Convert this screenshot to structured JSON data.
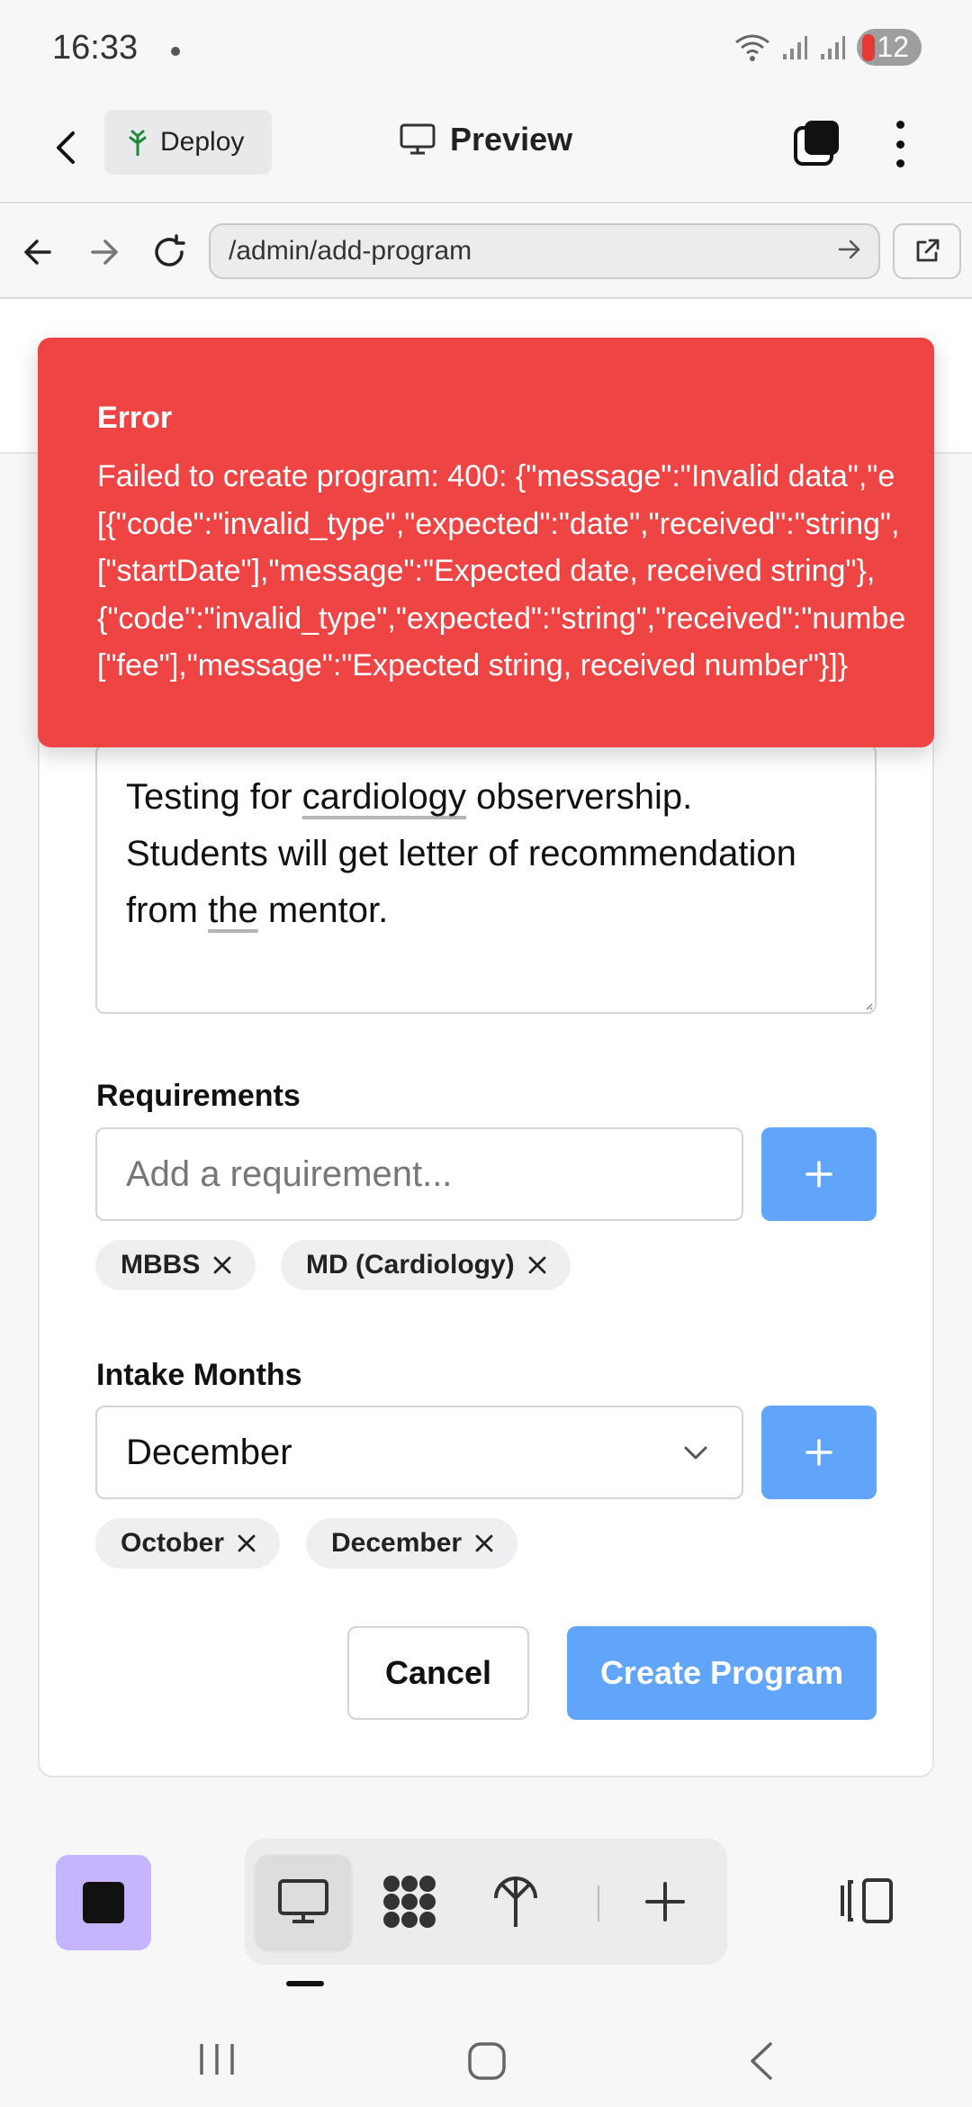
{
  "status_bar": {
    "time": "16:33",
    "notification_count": "12",
    "icons": [
      "wifi-icon",
      "signal-icon",
      "signal-icon"
    ]
  },
  "header": {
    "deploy_label": "Deploy",
    "preview_label": "Preview"
  },
  "browser": {
    "url": "/admin/add-program"
  },
  "error_toast": {
    "title": "Error",
    "message_lines": [
      "Failed to create program: 400: {\"message\":\"Invalid data\",\"e",
      "[{\"code\":\"invalid_type\",\"expected\":\"date\",\"received\":\"string\",",
      "[\"startDate\"],\"message\":\"Expected date, received string\"},",
      "{\"code\":\"invalid_type\",\"expected\":\"string\",\"received\":\"numbe",
      "[\"fee\"],\"message\":\"Expected string, received number\"}]}"
    ],
    "color": "#ef4444"
  },
  "form": {
    "description_lines": {
      "l1_pre": "Testing for ",
      "l1_u": "cardiology",
      "l1_post": " observership.",
      "l2": "Students will get letter of recommendation",
      "l3_pre": "from ",
      "l3_u": "the",
      "l3_post": " mentor."
    },
    "requirements": {
      "label": "Requirements",
      "placeholder": "Add a requirement...",
      "add_symbol": "+",
      "chips": [
        "MBBS",
        "MD (Cardiology)"
      ]
    },
    "intake_months": {
      "label": "Intake Months",
      "selected": "December",
      "add_symbol": "+",
      "chips": [
        "October",
        "December"
      ]
    },
    "cancel_label": "Cancel",
    "create_label": "Create Program",
    "accent": "#60a5fa"
  },
  "bottom_toolbar": {
    "tools": [
      "monitor-icon",
      "dots-grid-icon",
      "deploy-tree-icon",
      "plus-icon"
    ],
    "accent": "#c4b5fd"
  }
}
